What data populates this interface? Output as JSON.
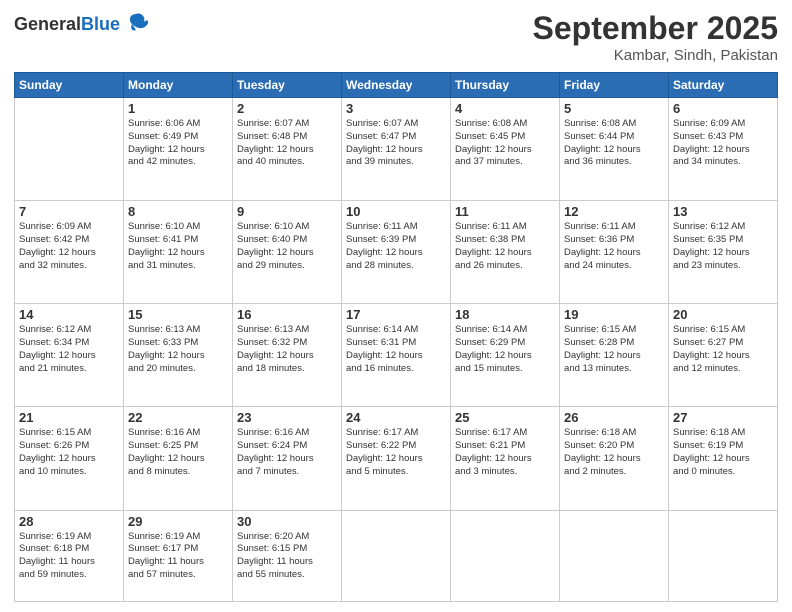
{
  "header": {
    "logo": {
      "general": "General",
      "blue": "Blue"
    },
    "title": "September 2025",
    "location": "Kambar, Sindh, Pakistan"
  },
  "days_of_week": [
    "Sunday",
    "Monday",
    "Tuesday",
    "Wednesday",
    "Thursday",
    "Friday",
    "Saturday"
  ],
  "weeks": [
    [
      {
        "day": "",
        "info": ""
      },
      {
        "day": "1",
        "info": "Sunrise: 6:06 AM\nSunset: 6:49 PM\nDaylight: 12 hours\nand 42 minutes."
      },
      {
        "day": "2",
        "info": "Sunrise: 6:07 AM\nSunset: 6:48 PM\nDaylight: 12 hours\nand 40 minutes."
      },
      {
        "day": "3",
        "info": "Sunrise: 6:07 AM\nSunset: 6:47 PM\nDaylight: 12 hours\nand 39 minutes."
      },
      {
        "day": "4",
        "info": "Sunrise: 6:08 AM\nSunset: 6:45 PM\nDaylight: 12 hours\nand 37 minutes."
      },
      {
        "day": "5",
        "info": "Sunrise: 6:08 AM\nSunset: 6:44 PM\nDaylight: 12 hours\nand 36 minutes."
      },
      {
        "day": "6",
        "info": "Sunrise: 6:09 AM\nSunset: 6:43 PM\nDaylight: 12 hours\nand 34 minutes."
      }
    ],
    [
      {
        "day": "7",
        "info": "Sunrise: 6:09 AM\nSunset: 6:42 PM\nDaylight: 12 hours\nand 32 minutes."
      },
      {
        "day": "8",
        "info": "Sunrise: 6:10 AM\nSunset: 6:41 PM\nDaylight: 12 hours\nand 31 minutes."
      },
      {
        "day": "9",
        "info": "Sunrise: 6:10 AM\nSunset: 6:40 PM\nDaylight: 12 hours\nand 29 minutes."
      },
      {
        "day": "10",
        "info": "Sunrise: 6:11 AM\nSunset: 6:39 PM\nDaylight: 12 hours\nand 28 minutes."
      },
      {
        "day": "11",
        "info": "Sunrise: 6:11 AM\nSunset: 6:38 PM\nDaylight: 12 hours\nand 26 minutes."
      },
      {
        "day": "12",
        "info": "Sunrise: 6:11 AM\nSunset: 6:36 PM\nDaylight: 12 hours\nand 24 minutes."
      },
      {
        "day": "13",
        "info": "Sunrise: 6:12 AM\nSunset: 6:35 PM\nDaylight: 12 hours\nand 23 minutes."
      }
    ],
    [
      {
        "day": "14",
        "info": "Sunrise: 6:12 AM\nSunset: 6:34 PM\nDaylight: 12 hours\nand 21 minutes."
      },
      {
        "day": "15",
        "info": "Sunrise: 6:13 AM\nSunset: 6:33 PM\nDaylight: 12 hours\nand 20 minutes."
      },
      {
        "day": "16",
        "info": "Sunrise: 6:13 AM\nSunset: 6:32 PM\nDaylight: 12 hours\nand 18 minutes."
      },
      {
        "day": "17",
        "info": "Sunrise: 6:14 AM\nSunset: 6:31 PM\nDaylight: 12 hours\nand 16 minutes."
      },
      {
        "day": "18",
        "info": "Sunrise: 6:14 AM\nSunset: 6:29 PM\nDaylight: 12 hours\nand 15 minutes."
      },
      {
        "day": "19",
        "info": "Sunrise: 6:15 AM\nSunset: 6:28 PM\nDaylight: 12 hours\nand 13 minutes."
      },
      {
        "day": "20",
        "info": "Sunrise: 6:15 AM\nSunset: 6:27 PM\nDaylight: 12 hours\nand 12 minutes."
      }
    ],
    [
      {
        "day": "21",
        "info": "Sunrise: 6:15 AM\nSunset: 6:26 PM\nDaylight: 12 hours\nand 10 minutes."
      },
      {
        "day": "22",
        "info": "Sunrise: 6:16 AM\nSunset: 6:25 PM\nDaylight: 12 hours\nand 8 minutes."
      },
      {
        "day": "23",
        "info": "Sunrise: 6:16 AM\nSunset: 6:24 PM\nDaylight: 12 hours\nand 7 minutes."
      },
      {
        "day": "24",
        "info": "Sunrise: 6:17 AM\nSunset: 6:22 PM\nDaylight: 12 hours\nand 5 minutes."
      },
      {
        "day": "25",
        "info": "Sunrise: 6:17 AM\nSunset: 6:21 PM\nDaylight: 12 hours\nand 3 minutes."
      },
      {
        "day": "26",
        "info": "Sunrise: 6:18 AM\nSunset: 6:20 PM\nDaylight: 12 hours\nand 2 minutes."
      },
      {
        "day": "27",
        "info": "Sunrise: 6:18 AM\nSunset: 6:19 PM\nDaylight: 12 hours\nand 0 minutes."
      }
    ],
    [
      {
        "day": "28",
        "info": "Sunrise: 6:19 AM\nSunset: 6:18 PM\nDaylight: 11 hours\nand 59 minutes."
      },
      {
        "day": "29",
        "info": "Sunrise: 6:19 AM\nSunset: 6:17 PM\nDaylight: 11 hours\nand 57 minutes."
      },
      {
        "day": "30",
        "info": "Sunrise: 6:20 AM\nSunset: 6:15 PM\nDaylight: 11 hours\nand 55 minutes."
      },
      {
        "day": "",
        "info": ""
      },
      {
        "day": "",
        "info": ""
      },
      {
        "day": "",
        "info": ""
      },
      {
        "day": "",
        "info": ""
      }
    ]
  ]
}
